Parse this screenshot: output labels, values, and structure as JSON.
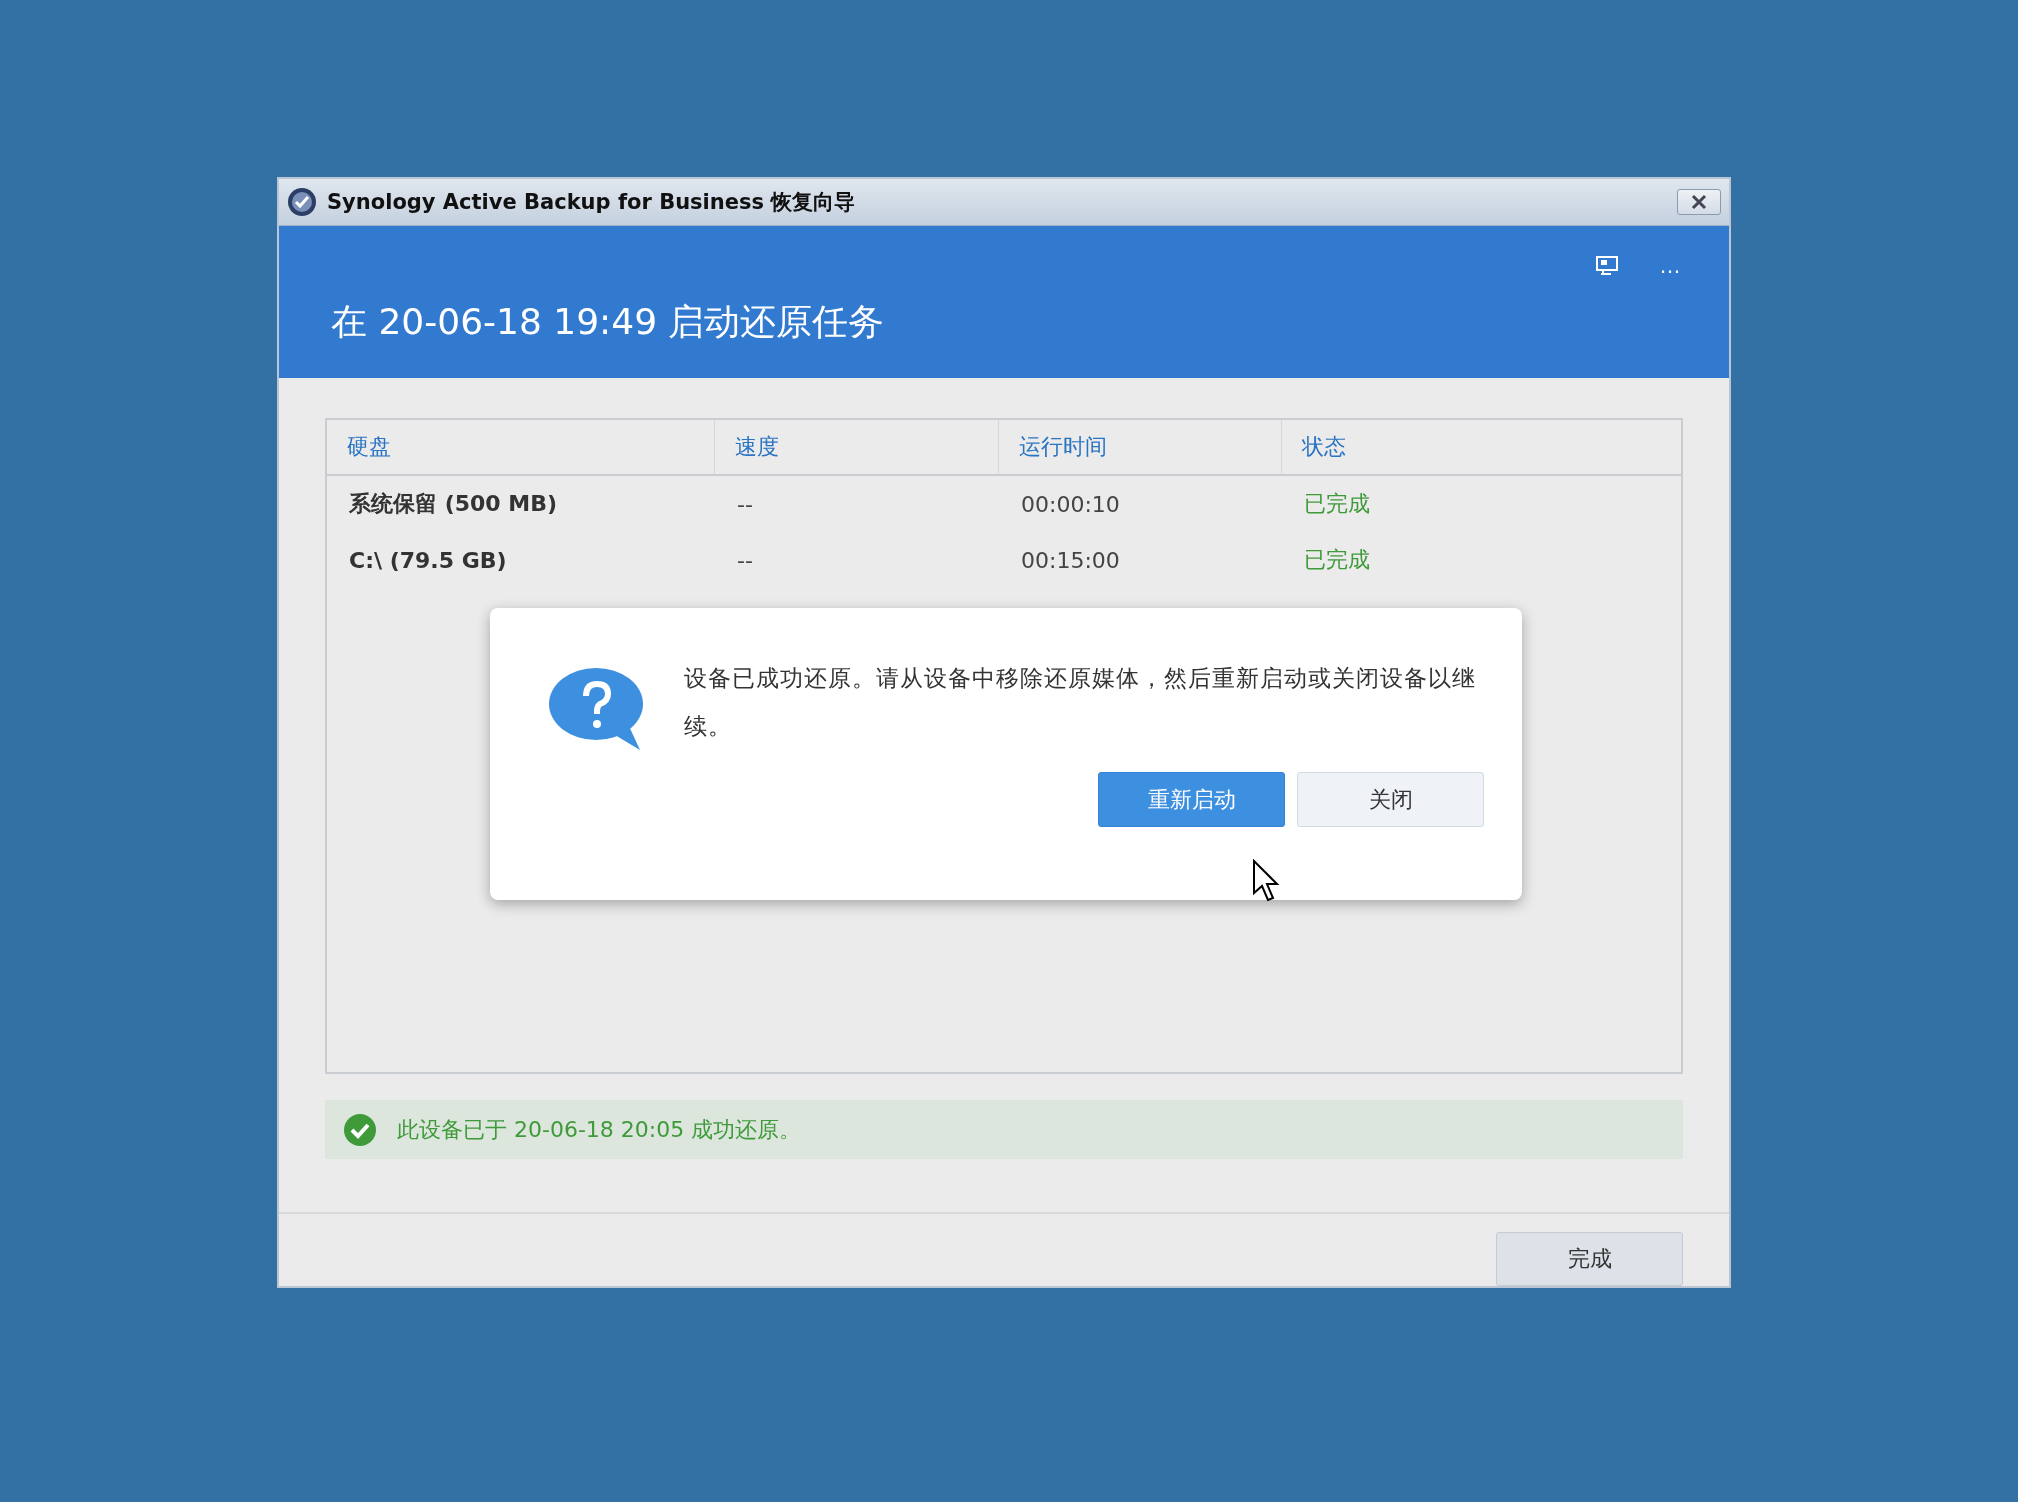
{
  "window": {
    "title": "Synology Active Backup for Business 恢复向导"
  },
  "header": {
    "title": "在 20-06-18 19:49 启动还原任务",
    "actions": [
      "…"
    ]
  },
  "table": {
    "columns": [
      "硬盘",
      "速度",
      "运行时间",
      "状态"
    ],
    "rows": [
      {
        "cells": [
          "系统保留 (500 MB)",
          "--",
          "00:00:10",
          "已完成"
        ]
      },
      {
        "cells": [
          "C:\\ (79.5 GB)",
          "--",
          "00:15:00",
          "已完成"
        ]
      }
    ]
  },
  "dialog": {
    "message": "设备已成功还原。请从设备中移除还原媒体，然后重新启动或关闭设备以继续。",
    "buttons": [
      {
        "label": "重新启动",
        "kind": "primary"
      },
      {
        "label": "关闭",
        "kind": "secondary"
      }
    ]
  },
  "status_bar": {
    "message": "此设备已于 20-06-18 20:05 成功还原。"
  },
  "footer": {
    "buttons": [
      "完成"
    ]
  }
}
